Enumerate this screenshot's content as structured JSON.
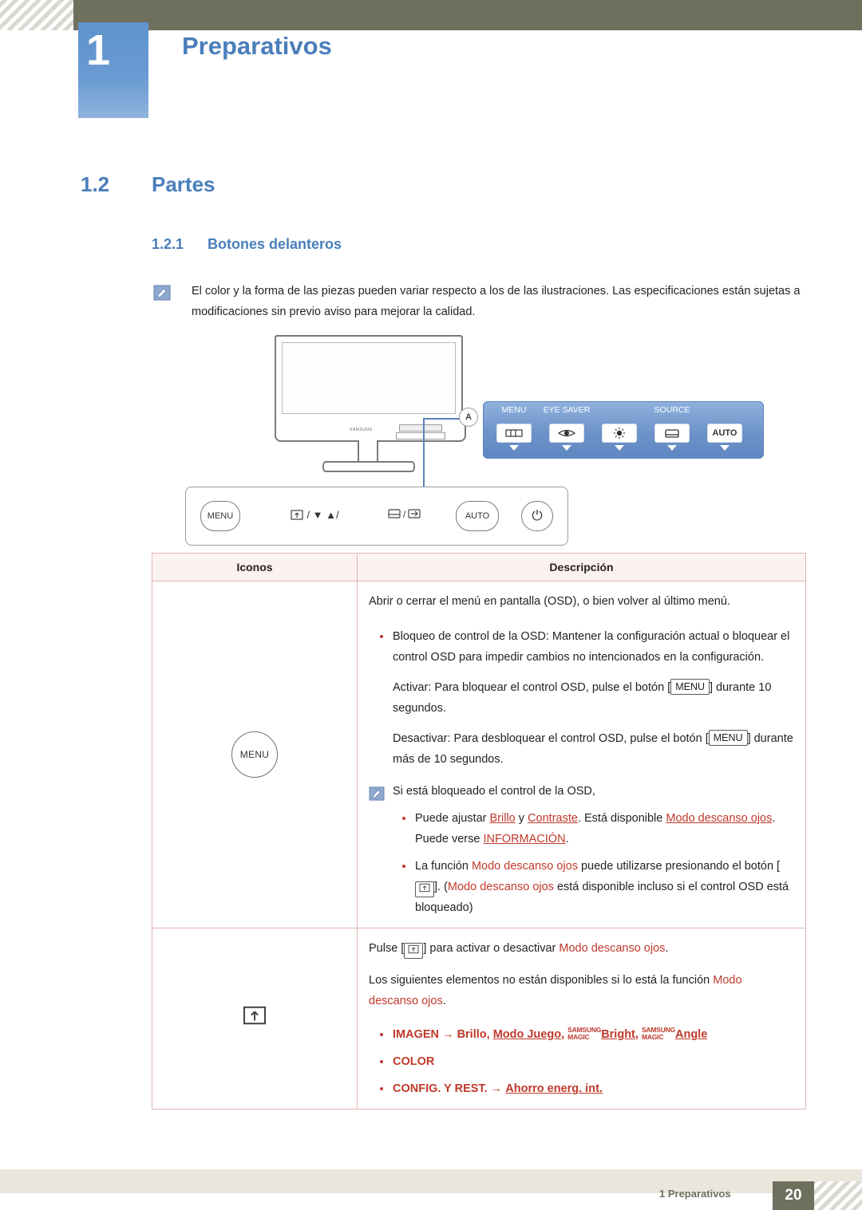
{
  "header": {
    "chapter_number": "1",
    "chapter_title": "Preparativos"
  },
  "section": {
    "number": "1.2",
    "title": "Partes",
    "sub_number": "1.2.1",
    "sub_title": "Botones delanteros"
  },
  "note": {
    "icon": "note-pencil-icon",
    "text": "El color y la forma de las piezas pueden variar respecto a los de las ilustraciones. Las especificaciones están sujetas a modificaciones sin previo aviso para mejorar la calidad."
  },
  "illustration": {
    "brand": "SAMSUNG",
    "callout_label": "A",
    "osd_items": [
      {
        "label": "MENU",
        "icon": "menu-bars-icon",
        "key": ""
      },
      {
        "label": "EYE SAVER",
        "icon": "eye-icon",
        "key": ""
      },
      {
        "label": "",
        "icon": "brightness-icon",
        "key": ""
      },
      {
        "label": "SOURCE",
        "icon": "source-icon",
        "key": ""
      },
      {
        "label": "",
        "icon": "auto-key",
        "key": "AUTO"
      }
    ],
    "strip_buttons": [
      {
        "name": "menu-button",
        "label": "MENU"
      },
      {
        "name": "down-up-button",
        "label": "/ ▼   ▲/"
      },
      {
        "name": "source-enter-button",
        "label": "/"
      },
      {
        "name": "auto-button",
        "label": "AUTO"
      },
      {
        "name": "power-button",
        "label": "⏻"
      }
    ]
  },
  "table": {
    "headers": [
      "Iconos",
      "Descripción"
    ],
    "rows": [
      {
        "icon_name": "menu-button-icon",
        "icon_label": "MENU",
        "lines": [
          {
            "type": "plain",
            "text": "Abrir o cerrar el menú en pantalla (OSD), o bien volver al último menú."
          },
          {
            "type": "bullet",
            "text": "Bloqueo de control de la OSD: Mantener la configuración actual o bloquear el control OSD para impedir cambios no intencionados en la configuración."
          },
          {
            "type": "indent",
            "text": "Activar: Para bloquear el control OSD, pulse el botón [MENU] durante 10 segundos."
          },
          {
            "type": "indent",
            "text": "Desactivar: Para desbloquear el control OSD, pulse el botón [MENU] durante más de 10 segundos."
          },
          {
            "type": "note",
            "text": "Si está bloqueado el control de la OSD,"
          },
          {
            "type": "sub-bullet",
            "text": "Puede ajustar Brillo y Contraste. Está disponible Modo descanso ojos. Puede verse INFORMACIÓN."
          },
          {
            "type": "sub-bullet",
            "text": "La función Modo descanso ojos puede utilizarse presionando el botón [ ]. (Modo descanso ojos está disponible incluso si el control OSD está bloqueado)"
          }
        ]
      },
      {
        "icon_name": "eye-saver-button-icon",
        "icon_label": "",
        "lines": [
          {
            "type": "plain",
            "text": "Pulse [ ] para activar o desactivar Modo descanso ojos."
          },
          {
            "type": "plain",
            "text": "Los siguientes elementos no están disponibles si lo está la función Modo descanso ojos."
          },
          {
            "type": "bullet",
            "text": "IMAGEN → Brillo, Modo Juego, SAMSUNG MAGIC Bright, SAMSUNG MAGIC Angle"
          },
          {
            "type": "bullet",
            "text": "COLOR"
          },
          {
            "type": "bullet",
            "text": "CONFIG. Y REST. → Ahorro energ. int."
          }
        ]
      }
    ],
    "inline_terms": {
      "brillo": "Brillo",
      "contraste": "Contraste",
      "modo_descanso": "Modo descanso ojos",
      "informacion": "INFORMACIÓN",
      "imagen": "IMAGEN",
      "modo_juego": "Modo Juego",
      "magic_brand": "SAMSUNG",
      "magic_word": "MAGIC",
      "bright": "Bright",
      "angle": "Angle",
      "color": "COLOR",
      "config": "CONFIG. Y REST.",
      "ahorro": "Ahorro energ. int.",
      "menu_key": "MENU",
      "arrow": "→"
    }
  },
  "footer": {
    "text": "1 Preparativos",
    "page": "20"
  },
  "colors": {
    "accent_blue": "#4a7ebb",
    "header_olive": "#6f6f5e",
    "table_border": "#e3b4b4",
    "red": "#c0392b"
  }
}
